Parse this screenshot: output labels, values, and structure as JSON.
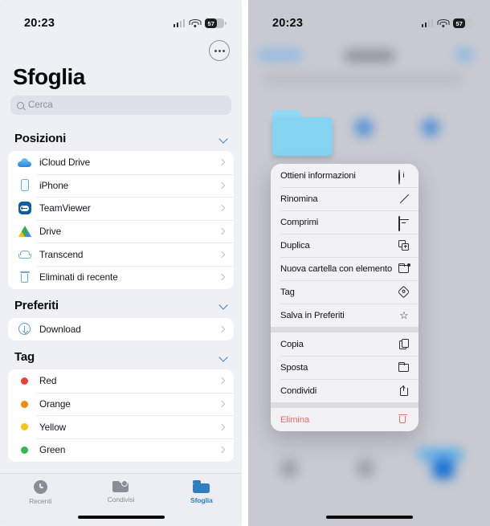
{
  "left_screen": {
    "status_bar": {
      "time": "20:23",
      "battery_level": "57",
      "signal_icon": "cellular-signal-icon",
      "wifi_icon": "wifi-icon"
    },
    "more_button": "more-options-icon",
    "page_title": "Sfoglia",
    "search": {
      "placeholder": "Cerca",
      "value": "",
      "icon": "search-icon"
    },
    "sections": [
      {
        "title": "Posizioni",
        "collapse_icon": "chevron-down-icon",
        "items": [
          {
            "label": "iCloud Drive",
            "icon": "icloud-drive-icon"
          },
          {
            "label": "iPhone",
            "icon": "iphone-icon"
          },
          {
            "label": "TeamViewer",
            "icon": "teamviewer-icon"
          },
          {
            "label": "Drive",
            "icon": "google-drive-icon"
          },
          {
            "label": "Transcend",
            "icon": "external-disk-icon"
          },
          {
            "label": "Eliminati di recente",
            "icon": "trash-icon"
          }
        ]
      },
      {
        "title": "Preferiti",
        "collapse_icon": "chevron-down-icon",
        "items": [
          {
            "label": "Download",
            "icon": "download-circle-icon"
          }
        ]
      },
      {
        "title": "Tag",
        "collapse_icon": "chevron-down-icon",
        "items": [
          {
            "label": "Red",
            "icon": "tag-dot-icon",
            "color": "#e8423a"
          },
          {
            "label": "Orange",
            "icon": "tag-dot-icon",
            "color": "#f08b18"
          },
          {
            "label": "Yellow",
            "icon": "tag-dot-icon",
            "color": "#f5c518"
          },
          {
            "label": "Green",
            "icon": "tag-dot-icon",
            "color": "#2fb94e"
          }
        ]
      }
    ],
    "tabs": [
      {
        "label": "Recenti",
        "icon": "clock-icon",
        "active": false
      },
      {
        "label": "Condivisi",
        "icon": "shared-folder-icon",
        "active": false
      },
      {
        "label": "Sfoglia",
        "icon": "folder-icon",
        "active": true
      }
    ]
  },
  "right_screen": {
    "status_bar": {
      "time": "20:23",
      "battery_level": "57",
      "signal_icon": "cellular-signal-icon",
      "wifi_icon": "wifi-icon"
    },
    "selected_item_icon": "selected-folder-icon",
    "context_menu": {
      "groups": [
        [
          {
            "label": "Ottieni informazioni",
            "icon": "info-circle-icon"
          },
          {
            "label": "Rinomina",
            "icon": "pencil-icon"
          },
          {
            "label": "Comprimi",
            "icon": "archive-box-icon"
          },
          {
            "label": "Duplica",
            "icon": "duplicate-icon"
          },
          {
            "label": "Nuova cartella con elemento",
            "icon": "new-folder-badge-icon"
          },
          {
            "label": "Tag",
            "icon": "tag-icon"
          },
          {
            "label": "Salva in Preferiti",
            "icon": "star-icon"
          }
        ],
        [
          {
            "label": "Copia",
            "icon": "copy-icon"
          },
          {
            "label": "Sposta",
            "icon": "folder-move-icon"
          },
          {
            "label": "Condividi",
            "icon": "share-icon"
          }
        ],
        [
          {
            "label": "Elimina",
            "icon": "trash-icon",
            "danger": true
          }
        ]
      ]
    }
  },
  "colors": {
    "accent_blue": "#2f7fc0",
    "danger_red": "#e2706c",
    "panel_bg": "#eef0f6",
    "card_bg": "#ffffff",
    "menu_bg": "#f2f2f4"
  }
}
